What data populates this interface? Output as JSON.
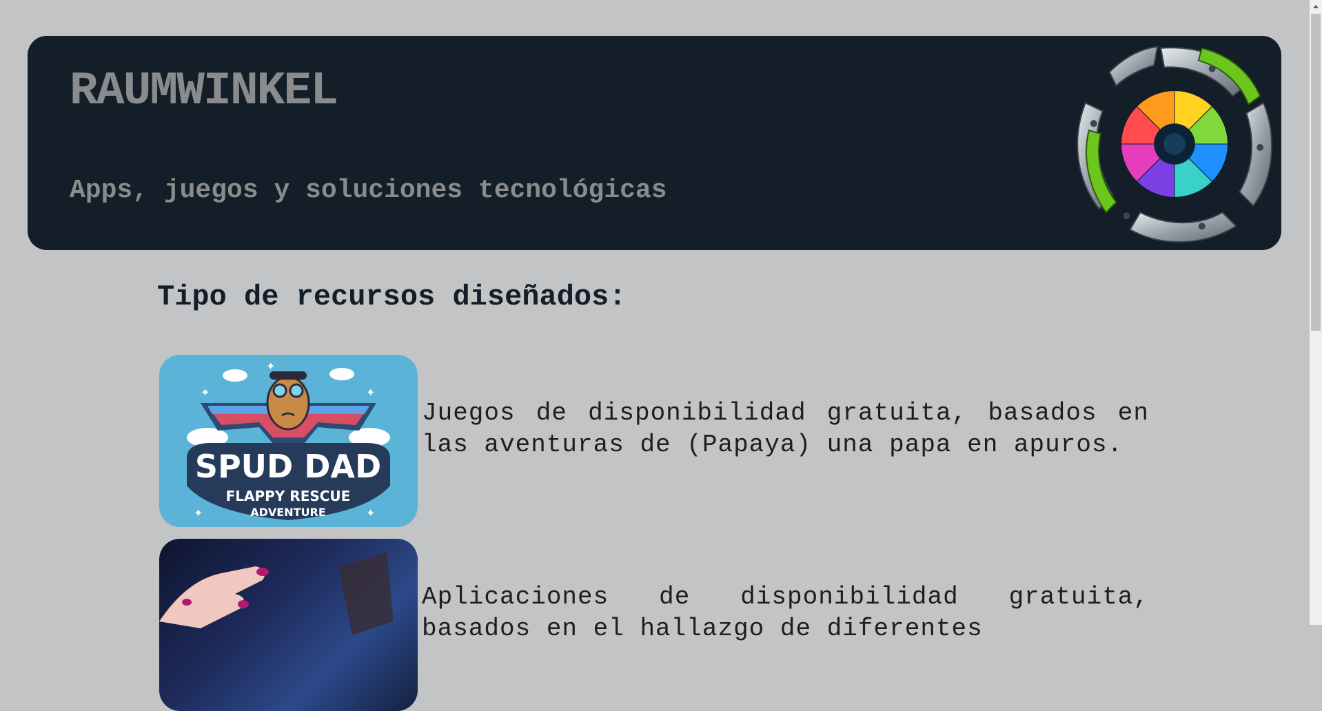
{
  "header": {
    "title": "RAUMWINKEL",
    "subtitle": "Apps, juegos y soluciones tecnológicas",
    "logo_icon": "aperture-logo-icon"
  },
  "main": {
    "heading": "Tipo de recursos diseñados:",
    "resources": [
      {
        "image_text": [
          "SPUD DAD",
          "FLAPPY RESCUE",
          "ADVENTURE"
        ],
        "description": "Juegos de disponibilidad gratuita, basados en las aventuras de (Papaya) una papa en apuros."
      },
      {
        "description": "Aplicaciones de disponibilidad gratuita, basados en el hallazgo de diferentes"
      }
    ]
  },
  "colors": {
    "page_background": "#c3c4c6",
    "header_background": "#131e28",
    "header_text": "#8a8b8d",
    "game_thumbnail_background": "#5bb3d8"
  }
}
